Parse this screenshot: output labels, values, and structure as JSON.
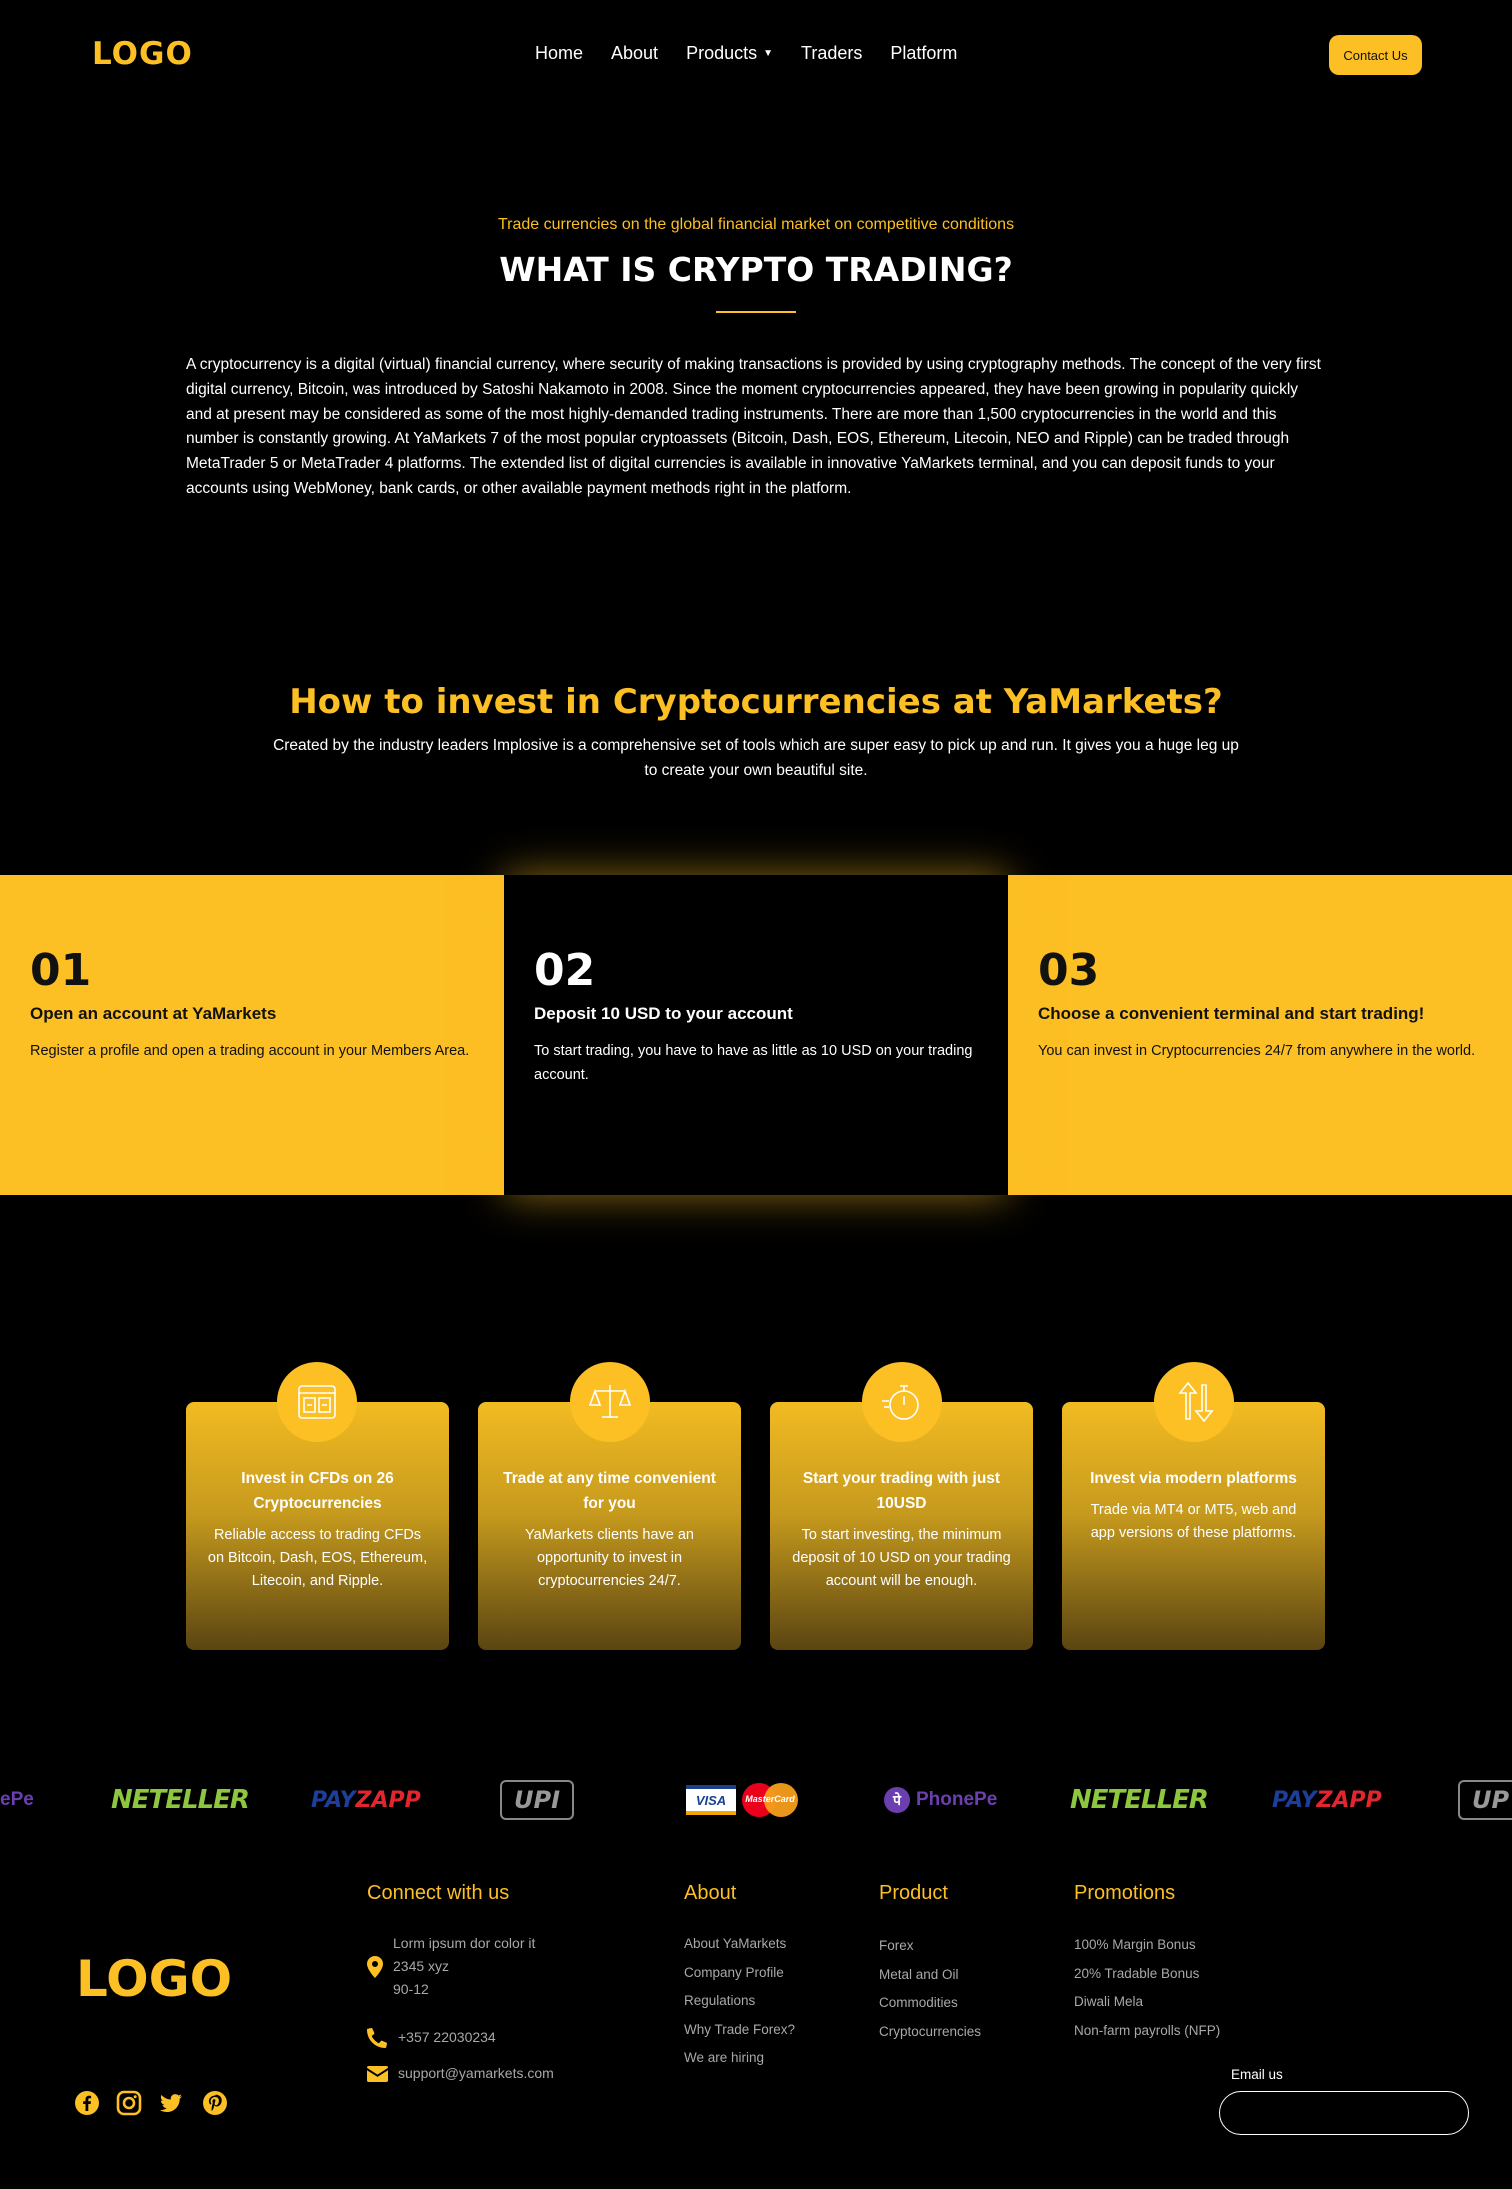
{
  "header": {
    "logo": "LOGO",
    "nav": [
      "Home",
      "About",
      "Products",
      "Traders",
      "Platform"
    ],
    "contact_label": "Contact Us"
  },
  "hero": {
    "kicker": "Trade currencies on the global financial market on competitive conditions",
    "title": "WHAT IS CRYPTO TRADING?",
    "body": "A cryptocurrency is a digital (virtual) financial currency, where security of making transactions is provided by using cryptography methods. The concept of the very first digital currency, Bitcoin, was introduced by Satoshi Nakamoto in 2008. Since the moment cryptocurrencies appeared, they have been growing in popularity quickly and at present may be considered as some of the most highly-demanded trading instruments. There are more than 1,500 cryptocurrencies in the world and this number is constantly growing. At YaMarkets 7 of the most popular cryptoassets (Bitcoin, Dash, EOS, Ethereum, Litecoin, NEO and Ripple) can be traded through MetaTrader 5 or MetaTrader 4 platforms. The extended list of digital currencies is available in innovative YaMarkets terminal, and you can deposit funds to your accounts using WebMoney, bank cards, or other available payment methods right in the platform."
  },
  "invest": {
    "title": "How to invest in Cryptocurrencies at YaMarkets?",
    "subtitle": "Created by the industry leaders Implosive is a comprehensive set of tools which are super easy to pick up and run. It gives you a huge leg up to create your own beautiful site."
  },
  "steps": [
    {
      "num": "01",
      "title": "Open an account at YaMarkets",
      "text": "Register a profile and open a trading account in your Members Area."
    },
    {
      "num": "02",
      "title": "Deposit 10 USD to your account",
      "text": "To start trading, you have to have as little as 10 USD on your trading account."
    },
    {
      "num": "03",
      "title": "Choose a convenient terminal and start trading!",
      "text": "You can invest in Cryptocurrencies 24/7 from anywhere in the world."
    }
  ],
  "features": [
    {
      "icon": "browser-chart-icon",
      "title": "Invest in CFDs on 26 Cryptocurrencies",
      "text": "Reliable access to trading CFDs on Bitcoin, Dash, EOS, Ethereum, Litecoin, and Ripple."
    },
    {
      "icon": "scales-icon",
      "title": "Trade at any time convenient for you",
      "text": "YaMarkets clients have an opportunity to invest in cryptocurrencies 24/7."
    },
    {
      "icon": "stopwatch-icon",
      "title": "Start your trading with just 10USD",
      "text": "To start investing, the minimum deposit of 10 USD on your trading account will be enough."
    },
    {
      "icon": "exchange-arrows-icon",
      "title": "Invest via modern platforms",
      "text": "Trade via MT4 or MT5, web and app versions of these platforms."
    }
  ],
  "payments": {
    "neteller": "NETELLER",
    "payzapp_pay": "PAY",
    "payzapp_zapp": "ZAPP",
    "upi": "UPI",
    "visa": "VISA",
    "mastercard": "MasterCard",
    "phonepe": "PhonePe",
    "phonepe_partial": "ePe",
    "upi_partial": "UP"
  },
  "footer": {
    "logo": "LOGO",
    "connect": {
      "title": "Connect with us",
      "address_line1": "Lorm ipsum dor color it",
      "address_line2": "2345 xyz",
      "address_line3": "90-12",
      "phone": "+357 22030234",
      "email": "support@yamarkets.com"
    },
    "about": {
      "title": "About",
      "links": [
        "About YaMarkets",
        "Company Profile",
        "Regulations",
        "Why Trade Forex?",
        "We are hiring"
      ]
    },
    "product": {
      "title": "Product",
      "links": [
        "Forex",
        "Metal and Oil",
        "Commodities",
        "Cryptocurrencies"
      ]
    },
    "promotions": {
      "title": "Promotions",
      "links": [
        "100% Margin Bonus",
        "20% Tradable Bonus",
        "Diwali Mela",
        "Non-farm payrolls (NFP)"
      ]
    },
    "email_label": "Email us",
    "social": [
      "facebook-icon",
      "instagram-icon",
      "twitter-icon",
      "pinterest-icon"
    ]
  },
  "colors": {
    "accent": "#fcbf24",
    "background": "#000000"
  }
}
